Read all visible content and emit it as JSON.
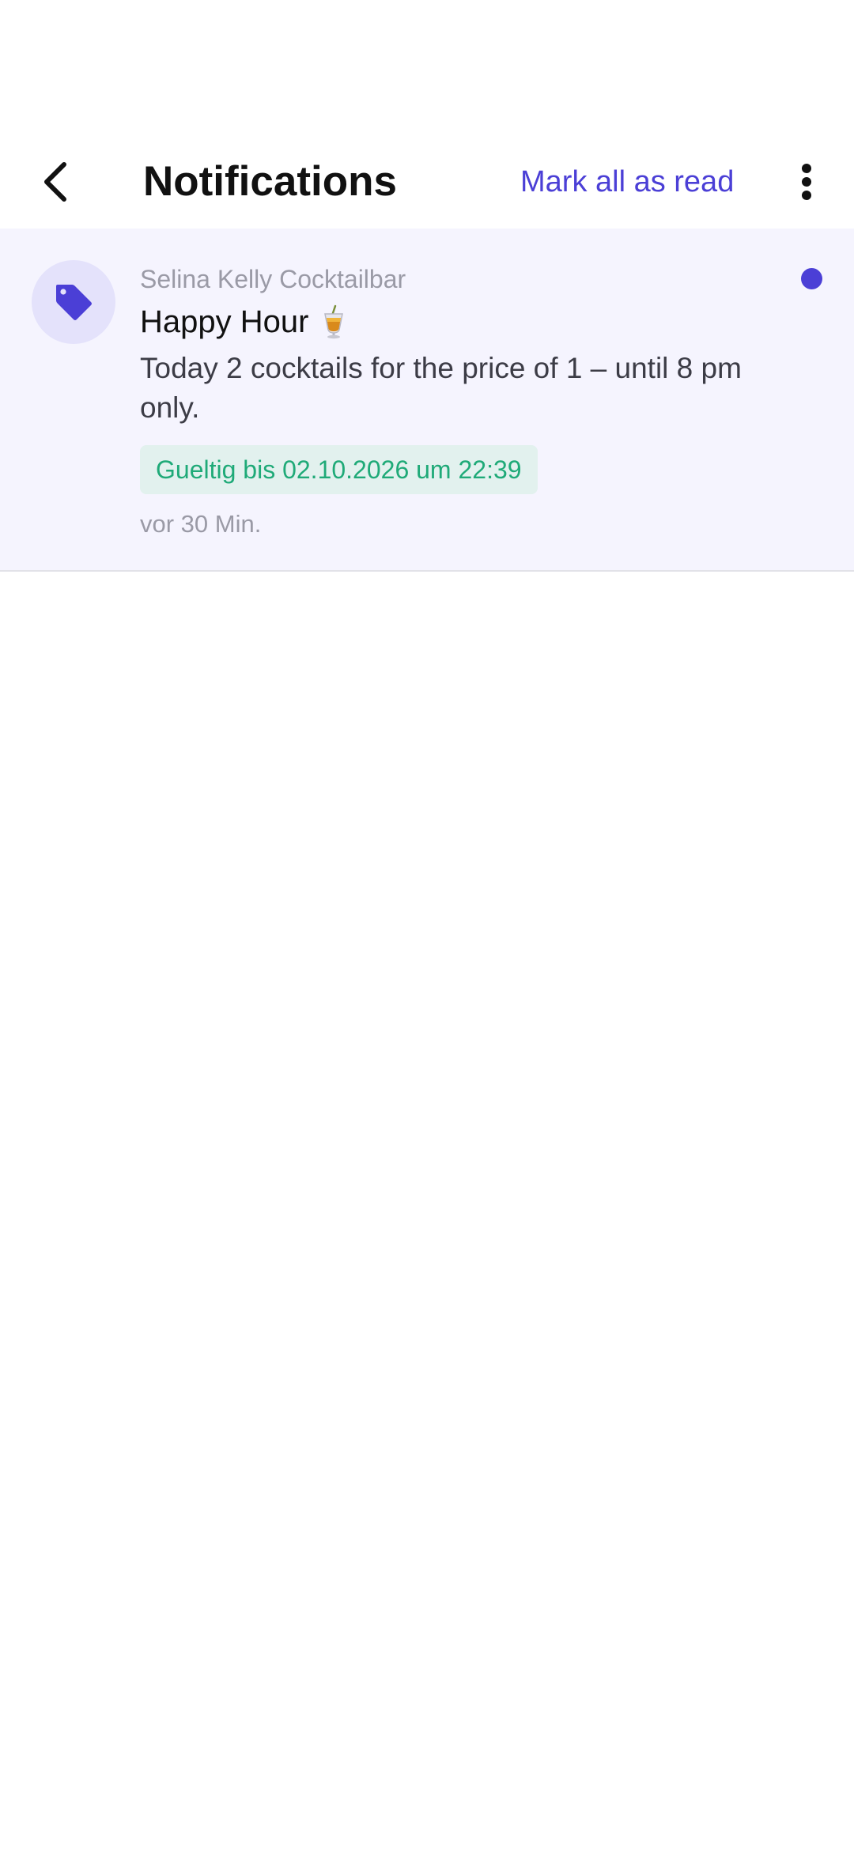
{
  "header": {
    "title": "Notifications",
    "mark_all_label": "Mark all as read",
    "back_icon": "chevron-left-icon",
    "more_icon": "more-vertical-icon"
  },
  "notifications": [
    {
      "sender": "Selina Kelly Cocktailbar",
      "title": "Happy Hour",
      "title_emoji": "🍹",
      "body": "Today 2 cocktails for the price of 1 – until 8 pm only.",
      "valid_until": "Gueltig bis 02.10.2026 um 22:39",
      "time_ago": "vor 30 Min.",
      "icon": "tag-icon",
      "unread": true
    }
  ],
  "colors": {
    "accent": "#4b3fd6",
    "unread_background": "#f5f4fe",
    "avatar_background": "#e4e2fb",
    "badge_background": "#e2f1ee",
    "badge_text": "#1faa78",
    "muted_text": "#9a9aa6"
  }
}
